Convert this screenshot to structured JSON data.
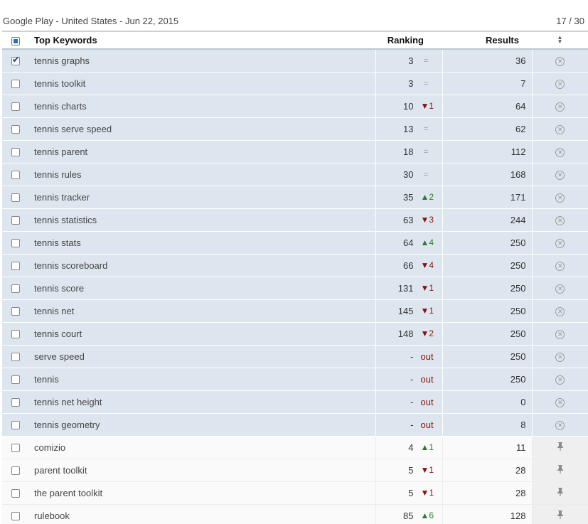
{
  "header": {
    "title": "Google Play - United States - Jun 22, 2015",
    "count": "17 / 30"
  },
  "columns": {
    "keyword": "Top Keywords",
    "ranking": "Ranking",
    "results": "Results"
  },
  "rows": [
    {
      "keyword": "tennis graphs",
      "rank": "3",
      "change": "=",
      "change_dir": "same",
      "results": "36",
      "checked": true,
      "group": "selected",
      "action_icon": "remove-icon"
    },
    {
      "keyword": "tennis toolkit",
      "rank": "3",
      "change": "=",
      "change_dir": "same",
      "results": "7",
      "checked": false,
      "group": "selected",
      "action_icon": "remove-icon"
    },
    {
      "keyword": "tennis charts",
      "rank": "10",
      "change": "▼1",
      "change_dir": "down",
      "results": "64",
      "checked": false,
      "group": "selected",
      "action_icon": "remove-icon"
    },
    {
      "keyword": "tennis serve speed",
      "rank": "13",
      "change": "=",
      "change_dir": "same",
      "results": "62",
      "checked": false,
      "group": "selected",
      "action_icon": "remove-icon"
    },
    {
      "keyword": "tennis parent",
      "rank": "18",
      "change": "=",
      "change_dir": "same",
      "results": "112",
      "checked": false,
      "group": "selected",
      "action_icon": "remove-icon"
    },
    {
      "keyword": "tennis rules",
      "rank": "30",
      "change": "=",
      "change_dir": "same",
      "results": "168",
      "checked": false,
      "group": "selected",
      "action_icon": "remove-icon"
    },
    {
      "keyword": "tennis tracker",
      "rank": "35",
      "change": "▲2",
      "change_dir": "up",
      "results": "171",
      "checked": false,
      "group": "selected",
      "action_icon": "remove-icon"
    },
    {
      "keyword": "tennis statistics",
      "rank": "63",
      "change": "▼3",
      "change_dir": "down",
      "results": "244",
      "checked": false,
      "group": "selected",
      "action_icon": "remove-icon"
    },
    {
      "keyword": "tennis stats",
      "rank": "64",
      "change": "▲4",
      "change_dir": "up",
      "results": "250",
      "checked": false,
      "group": "selected",
      "action_icon": "remove-icon"
    },
    {
      "keyword": "tennis scoreboard",
      "rank": "66",
      "change": "▼4",
      "change_dir": "down",
      "results": "250",
      "checked": false,
      "group": "selected",
      "action_icon": "remove-icon"
    },
    {
      "keyword": "tennis score",
      "rank": "131",
      "change": "▼1",
      "change_dir": "down",
      "results": "250",
      "checked": false,
      "group": "selected",
      "action_icon": "remove-icon"
    },
    {
      "keyword": "tennis net",
      "rank": "145",
      "change": "▼1",
      "change_dir": "down",
      "results": "250",
      "checked": false,
      "group": "selected",
      "action_icon": "remove-icon"
    },
    {
      "keyword": "tennis court",
      "rank": "148",
      "change": "▼2",
      "change_dir": "down",
      "results": "250",
      "checked": false,
      "group": "selected",
      "action_icon": "remove-icon"
    },
    {
      "keyword": "serve speed",
      "rank": "-",
      "change": "out",
      "change_dir": "out",
      "results": "250",
      "checked": false,
      "group": "selected",
      "action_icon": "remove-icon"
    },
    {
      "keyword": "tennis",
      "rank": "-",
      "change": "out",
      "change_dir": "out",
      "results": "250",
      "checked": false,
      "group": "selected",
      "action_icon": "remove-icon"
    },
    {
      "keyword": "tennis net height",
      "rank": "-",
      "change": "out",
      "change_dir": "out",
      "results": "0",
      "results_muted": true,
      "checked": false,
      "group": "selected",
      "action_icon": "remove-icon"
    },
    {
      "keyword": "tennis geometry",
      "rank": "-",
      "change": "out",
      "change_dir": "out",
      "results": "8",
      "checked": false,
      "group": "selected",
      "action_icon": "remove-icon"
    },
    {
      "keyword": "comizio",
      "rank": "4",
      "change": "▲1",
      "change_dir": "up",
      "results": "11",
      "checked": false,
      "group": "pinned",
      "action_icon": "pin-icon"
    },
    {
      "keyword": "parent toolkit",
      "rank": "5",
      "change": "▼1",
      "change_dir": "down",
      "results": "28",
      "checked": false,
      "group": "pinned",
      "action_icon": "pin-icon"
    },
    {
      "keyword": "the parent toolkit",
      "rank": "5",
      "change": "▼1",
      "change_dir": "down",
      "results": "28",
      "checked": false,
      "group": "pinned",
      "action_icon": "pin-icon"
    },
    {
      "keyword": "rulebook",
      "rank": "85",
      "change": "▲6",
      "change_dir": "up",
      "results": "128",
      "checked": false,
      "group": "pinned",
      "action_icon": "pin-icon"
    }
  ],
  "colors": {
    "selected_row_bg": "#dde6ee",
    "down": "#8b1010",
    "up": "#2a7d2a",
    "same": "#aaaaaa"
  }
}
